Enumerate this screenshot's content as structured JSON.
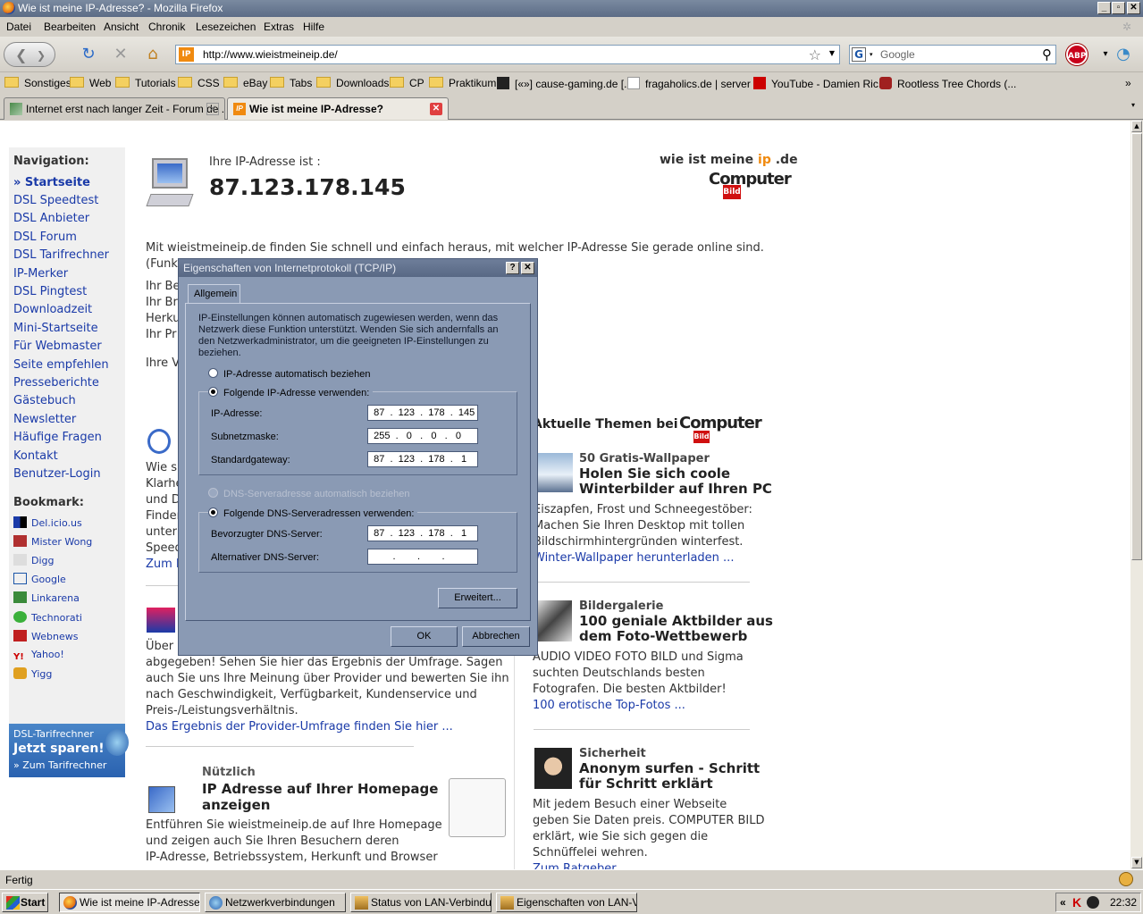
{
  "window": {
    "title": "Wie ist meine IP-Adresse? - Mozilla Firefox"
  },
  "menu": [
    "Datei",
    "Bearbeiten",
    "Ansicht",
    "Chronik",
    "Lesezeichen",
    "Extras",
    "Hilfe"
  ],
  "nav": {
    "url": "http://www.wieistmeineip.de/",
    "search_placeholder": "Google",
    "abp_label": "ABP"
  },
  "bookmarks": [
    "Sonstiges",
    "Web",
    "Tutorials",
    "CSS",
    "eBay",
    "Tabs",
    "Downloads",
    "CP",
    "Praktikum",
    "[«»] cause-gaming.de [...",
    "fragaholics.de | server ...",
    "YouTube - Damien Ric...",
    "Rootless Tree Chords (..."
  ],
  "tabs": [
    {
      "label": "Internet erst nach langer Zeit - Forum de ..."
    },
    {
      "label": "Wie ist meine IP-Adresse?"
    }
  ],
  "page": {
    "nav_heading": "Navigation:",
    "nav_items": [
      "» Startseite",
      "DSL Speedtest",
      "DSL Anbieter",
      "DSL Forum",
      "DSL Tarifrechner",
      "IP-Merker",
      "DSL Pingtest",
      "Downloadzeit",
      "Mini-Startseite",
      "Für Webmaster",
      "Seite empfehlen",
      "Presseberichte",
      "Gästebuch",
      "Newsletter",
      "Häufige Fragen",
      "Kontakt",
      "Benutzer-Login"
    ],
    "bookmark_heading": "Bookmark:",
    "bookmark_items": [
      "Del.icio.us",
      "Mister Wong",
      "Digg",
      "Google",
      "Linkarena",
      "Technorati",
      "Webnews",
      "Yahoo!",
      "Yigg"
    ],
    "tarif": {
      "line1": "DSL-Tarifrechner",
      "line2": "Jetzt sparen!",
      "line3": "» Zum Tarifrechner"
    },
    "ip_label": "Ihre IP-Adresse ist :",
    "ip_value": "87.123.178.145",
    "logo": {
      "a": "wie ist meine ",
      "b": "ip",
      "c": " .de",
      "brand": "Computer",
      "brand_sub": "Bild"
    },
    "intro": "Mit wieistmeineip.de finden Sie schnell und einfach heraus, mit welcher IP-Adresse Sie gerade online sind.",
    "intro2": "(Funk",
    "partial_lines": [
      "Ihr Be",
      "Ihr Br",
      "Herku",
      "Ihr Pr"
    ],
    "partial_ihre": "Ihre V",
    "left_snips": [
      "Wie s",
      "Klarhe",
      "und D",
      "Finder",
      "unter",
      "Speed"
    ],
    "left_zum": "Zum k",
    "umfrage_uber": "Über",
    "umfrage_text": [
      "abgegeben! Sehen Sie hier das Ergebnis der Umfrage. Sagen",
      "auch Sie uns Ihre Meinung über Provider und bewerten Sie ihn",
      "nach Geschwindigkeit, Verfügbarkeit, Kundenservice und",
      "Preis-/Leistungsverhältnis."
    ],
    "umfrage_link": "Das Ergebnis der Provider-Umfrage finden Sie hier ...",
    "nuetzlich": {
      "kicker": "Nützlich",
      "title1": "IP Adresse auf Ihrer Homepage",
      "title2": "anzeigen",
      "text": [
        "Entführen Sie wieistmeineip.de auf Ihre Homepage",
        "und zeigen auch Sie Ihren Besuchern deren",
        "IP-Adresse, Betriebssystem, Herkunft und Browser"
      ]
    },
    "themen_heading": "Aktuelle Themen bei",
    "themen": [
      {
        "kicker": "50 Gratis-Wallpaper",
        "title": [
          "Holen Sie sich coole",
          "Winterbilder auf Ihren PC"
        ],
        "text": [
          "Eiszapfen, Frost und Schneegestöber:",
          "Machen Sie Ihren Desktop mit tollen",
          "Bildschirmhintergründen winterfest."
        ],
        "link": "Winter-Wallpaper herunterladen ..."
      },
      {
        "kicker": "Bildergalerie",
        "title": [
          "100 geniale Aktbilder aus",
          "dem Foto-Wettbewerb"
        ],
        "text": [
          "AUDIO VIDEO FOTO BILD und Sigma",
          "suchten Deutschlands besten",
          "Fotografen. Die besten Aktbilder!"
        ],
        "link": "100 erotische Top-Fotos ..."
      },
      {
        "kicker": "Sicherheit",
        "title": [
          "Anonym surfen - Schritt",
          "für Schritt erklärt"
        ],
        "text": [
          "Mit jedem Besuch einer Webseite",
          "geben Sie Daten preis. COMPUTER BILD",
          "erklärt, wie Sie sich gegen die",
          "Schnüffelei wehren."
        ],
        "link": "Zum Ratgeber"
      }
    ]
  },
  "dialog": {
    "title": "Eigenschaften von Internetprotokoll (TCP/IP)",
    "tab": "Allgemein",
    "desc": [
      "IP-Einstellungen können automatisch zugewiesen werden, wenn das",
      "Netzwerk diese Funktion unterstützt. Wenden Sie sich andernfalls an",
      "den Netzwerkadministrator, um die geeigneten IP-Einstellungen zu",
      "beziehen."
    ],
    "radio_auto_ip": "IP-Adresse automatisch beziehen",
    "radio_manual_ip": "Folgende IP-Adresse verwenden:",
    "ip_label": "IP-Adresse:",
    "ip": "  87  .  123  .  178  .  145",
    "mask_label": "Subnetzmaske:",
    "mask": "  255  .   0   .   0   .   0",
    "gw_label": "Standardgateway:",
    "gw": "  87  .  123  .  178  .   1",
    "radio_auto_dns": "DNS-Serveradresse automatisch beziehen",
    "radio_manual_dns": "Folgende DNS-Serveradressen verwenden:",
    "dns1_label": "Bevorzugter DNS-Server:",
    "dns1": "  87  .  123  .  178  .   1",
    "dns2_label": "Alternativer DNS-Server:",
    "dns2": "         .        .        .",
    "advanced": "Erweitert...",
    "ok": "OK",
    "cancel": "Abbrechen"
  },
  "status": "Fertig",
  "taskbar": {
    "start": "Start",
    "items": [
      "Wie ist meine IP-Adresse?...",
      "Netzwerkverbindungen",
      "Status von LAN-Verbindu...",
      "Eigenschaften von LAN-V..."
    ],
    "clock": "22:32"
  }
}
